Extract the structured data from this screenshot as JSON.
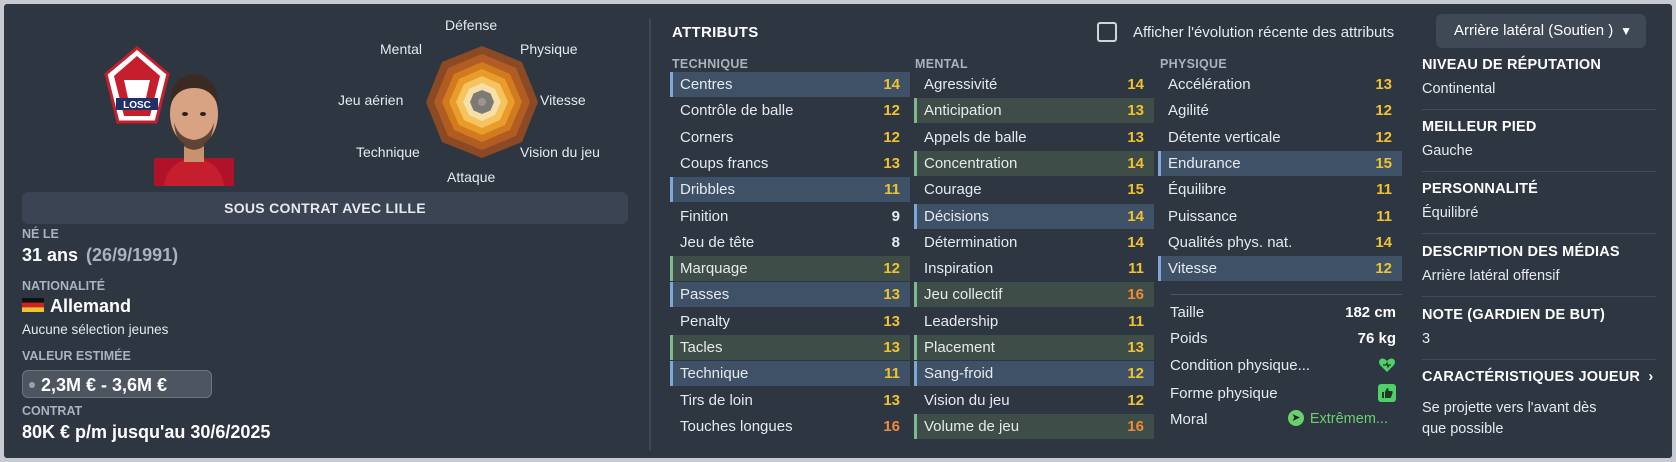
{
  "player": {
    "contract_banner": "SOUS CONTRAT AVEC LILLE",
    "born_label": "NÉ LE",
    "age": "31 ans",
    "birth_date": "(26/9/1991)",
    "nationality_label": "NATIONALITÉ",
    "nationality": "Allemand",
    "flag_icon": "germany-flag-icon",
    "caps_text": "Aucune sélection jeunes",
    "value_label": "VALEUR ESTIMÉE",
    "value": "2,3M € - 3,6M €",
    "contract_label": "CONTRAT",
    "contract": "80K € p/m jusqu'au 30/6/2025"
  },
  "club": {
    "logo_text": "LOSC",
    "logo_icon": "losc-club-logo"
  },
  "radar": {
    "labels": {
      "defense": "Défense",
      "physique": "Physique",
      "vitesse": "Vitesse",
      "vision": "Vision du jeu",
      "attaque": "Attaque",
      "technique": "Technique",
      "jeu_aerien": "Jeu aérien",
      "mental": "Mental"
    }
  },
  "attributes": {
    "title": "ATTRIBUTS",
    "show_evolution_label": "Afficher l'évolution récente des attributs",
    "role_select": "Arrière latéral (Soutien )",
    "columns": {
      "technique": "TECHNIQUE",
      "mental": "MENTAL",
      "physique": "PHYSIQUE"
    },
    "technique": [
      {
        "name": "Centres",
        "value": "14",
        "hl": "blue"
      },
      {
        "name": "Contrôle de balle",
        "value": "12",
        "hl": ""
      },
      {
        "name": "Corners",
        "value": "12",
        "hl": ""
      },
      {
        "name": "Coups francs",
        "value": "13",
        "hl": ""
      },
      {
        "name": "Dribbles",
        "value": "11",
        "hl": "blue"
      },
      {
        "name": "Finition",
        "value": "9",
        "hl": ""
      },
      {
        "name": "Jeu de tête",
        "value": "8",
        "hl": ""
      },
      {
        "name": "Marquage",
        "value": "12",
        "hl": "green"
      },
      {
        "name": "Passes",
        "value": "13",
        "hl": "blue"
      },
      {
        "name": "Penalty",
        "value": "13",
        "hl": ""
      },
      {
        "name": "Tacles",
        "value": "13",
        "hl": "green"
      },
      {
        "name": "Technique",
        "value": "11",
        "hl": "blue"
      },
      {
        "name": "Tirs de loin",
        "value": "13",
        "hl": ""
      },
      {
        "name": "Touches longues",
        "value": "16",
        "hl": ""
      }
    ],
    "mental": [
      {
        "name": "Agressivité",
        "value": "14",
        "hl": ""
      },
      {
        "name": "Anticipation",
        "value": "13",
        "hl": "green"
      },
      {
        "name": "Appels de balle",
        "value": "13",
        "hl": ""
      },
      {
        "name": "Concentration",
        "value": "14",
        "hl": "green"
      },
      {
        "name": "Courage",
        "value": "15",
        "hl": ""
      },
      {
        "name": "Décisions",
        "value": "14",
        "hl": "blue"
      },
      {
        "name": "Détermination",
        "value": "14",
        "hl": ""
      },
      {
        "name": "Inspiration",
        "value": "11",
        "hl": ""
      },
      {
        "name": "Jeu collectif",
        "value": "16",
        "hl": "green"
      },
      {
        "name": "Leadership",
        "value": "11",
        "hl": ""
      },
      {
        "name": "Placement",
        "value": "13",
        "hl": "green"
      },
      {
        "name": "Sang-froid",
        "value": "12",
        "hl": "blue"
      },
      {
        "name": "Vision du jeu",
        "value": "12",
        "hl": ""
      },
      {
        "name": "Volume de jeu",
        "value": "16",
        "hl": "green"
      }
    ],
    "physique": [
      {
        "name": "Accélération",
        "value": "13",
        "hl": ""
      },
      {
        "name": "Agilité",
        "value": "12",
        "hl": ""
      },
      {
        "name": "Détente verticale",
        "value": "12",
        "hl": ""
      },
      {
        "name": "Endurance",
        "value": "15",
        "hl": "blue"
      },
      {
        "name": "Équilibre",
        "value": "11",
        "hl": ""
      },
      {
        "name": "Puissance",
        "value": "11",
        "hl": ""
      },
      {
        "name": "Qualités phys. nat.",
        "value": "14",
        "hl": ""
      },
      {
        "name": "Vitesse",
        "value": "12",
        "hl": "blue"
      }
    ]
  },
  "physical_info": {
    "height_label": "Taille",
    "height": "182 cm",
    "weight_label": "Poids",
    "weight": "76 kg",
    "condition_label": "Condition physique...",
    "condition_icon": "heart-icon",
    "form_label": "Forme physique",
    "form_icon": "thumbs-up-icon",
    "morale_label": "Moral",
    "morale": "Extrêmem...",
    "morale_icon": "arrow-up-icon"
  },
  "profile": {
    "reputation_label": "NIVEAU DE RÉPUTATION",
    "reputation": "Continental",
    "foot_label": "MEILLEUR PIED",
    "foot": "Gauche",
    "personality_label": "PERSONNALITÉ",
    "personality": "Équilibré",
    "media_label": "DESCRIPTION DES MÉDIAS",
    "media": "Arrière latéral offensif",
    "gk_label": "NOTE (GARDIEN DE BUT)",
    "gk": "3",
    "traits_label": "CARACTÉRISTIQUES JOUEUR",
    "traits": "Se projette vers l'avant dès que possible"
  },
  "colors": {
    "panel": "#2e3642",
    "value_white": "#e6e9ee",
    "value_yellow": "#f0c22e",
    "value_orange": "#ee8a3a",
    "highlight_blue": "#3e5167",
    "highlight_green": "#3e4d47"
  }
}
